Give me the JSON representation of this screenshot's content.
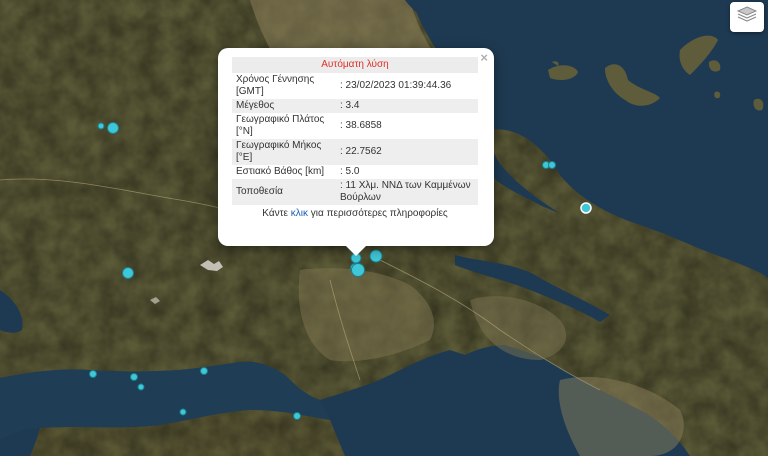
{
  "colors": {
    "sea": "#1e3a52",
    "land": "#5a5634",
    "marker": "#3fc7d8",
    "popup_title": "#e03028",
    "link": "#1a5fb4"
  },
  "map": {
    "layers_icon": "layers-icon"
  },
  "popup": {
    "title": "Αυτόματη λύση",
    "close": "×",
    "rows": [
      {
        "key": "Χρόνος Γέννησης [GMT]",
        "value": ": 23/02/2023 01:39:44.36"
      },
      {
        "key": "Μέγεθος",
        "value": ": 3.4"
      },
      {
        "key": "Γεωγραφικό Πλάτος [°N]",
        "value": ": 38.6858"
      },
      {
        "key": "Γεωγραφικό Μήκος [°E]",
        "value": ": 22.7562"
      },
      {
        "key": "Εστιακό Βάθος [km]",
        "value": ": 5.0"
      },
      {
        "key": "Τοποθεσία",
        "value": ": 11 Χλμ. ΝΝΔ των Καμμένων Βούρλων"
      }
    ],
    "footer_before": "Κάντε ",
    "footer_link": "κλικ",
    "footer_after": " για περισσότερες πληροφορίες"
  }
}
